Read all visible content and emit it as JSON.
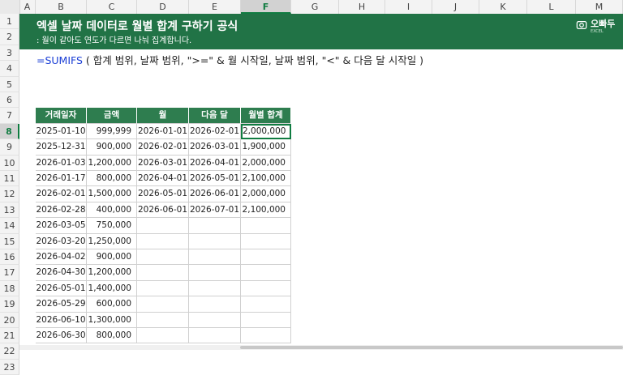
{
  "columns": [
    "A",
    "B",
    "C",
    "D",
    "E",
    "F",
    "G",
    "H",
    "I",
    "J",
    "K",
    "L",
    "M"
  ],
  "active_column": "F",
  "rows": [
    "1",
    "2",
    "3",
    "4",
    "5",
    "6",
    "7",
    "8",
    "9",
    "10",
    "11",
    "12",
    "13",
    "14",
    "15",
    "16",
    "17",
    "18",
    "19",
    "20",
    "21",
    "22",
    "23"
  ],
  "active_row": "8",
  "banner": {
    "title": "엑셀 날짜 데이터로 월별 합계 구하기 공식",
    "subtitle": ": 월이 같아도 연도가 다르면 나눠 집계합니다.",
    "logo_text": "오빠두",
    "logo_sub": "EXCEL"
  },
  "formula": {
    "fn": "=SUMIFS",
    "args": " ( 합계 범위, 날짜 범위, \">=\" & 월 시작일, 날짜 범위, \"<\" & 다음 달 시작일 )"
  },
  "table": {
    "headers": [
      "거래일자",
      "금액",
      "월",
      "다음 달",
      "월별 합계"
    ],
    "rows": [
      [
        "2025-01-10",
        "999,999",
        "2026-01-01",
        "2026-02-01",
        "2,000,000"
      ],
      [
        "2025-12-31",
        "900,000",
        "2026-02-01",
        "2026-03-01",
        "1,900,000"
      ],
      [
        "2026-01-03",
        "1,200,000",
        "2026-03-01",
        "2026-04-01",
        "2,000,000"
      ],
      [
        "2026-01-17",
        "800,000",
        "2026-04-01",
        "2026-05-01",
        "2,100,000"
      ],
      [
        "2026-02-01",
        "1,500,000",
        "2026-05-01",
        "2026-06-01",
        "2,000,000"
      ],
      [
        "2026-02-28",
        "400,000",
        "2026-06-01",
        "2026-07-01",
        "2,100,000"
      ],
      [
        "2026-03-05",
        "750,000",
        "",
        "",
        ""
      ],
      [
        "2026-03-20",
        "1,250,000",
        "",
        "",
        ""
      ],
      [
        "2026-04-02",
        "900,000",
        "",
        "",
        ""
      ],
      [
        "2026-04-30",
        "1,200,000",
        "",
        "",
        ""
      ],
      [
        "2026-05-01",
        "1,400,000",
        "",
        "",
        ""
      ],
      [
        "2026-05-29",
        "600,000",
        "",
        "",
        ""
      ],
      [
        "2026-06-10",
        "1,300,000",
        "",
        "",
        ""
      ],
      [
        "2026-06-30",
        "800,000",
        "",
        "",
        ""
      ]
    ]
  },
  "colors": {
    "banner_green": "#217346",
    "header_green": "#2e7d4f",
    "selection": "#107c41",
    "function_blue": "#1b3fd6"
  }
}
